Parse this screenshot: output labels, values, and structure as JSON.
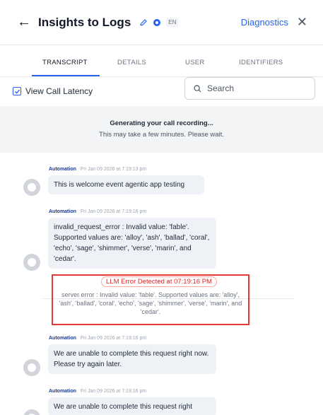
{
  "header": {
    "title": "Insights to Logs",
    "language_badge": "EN",
    "diagnostics_label": "Diagnostics",
    "back_icon": "←",
    "close_icon": "✕"
  },
  "tabs": [
    {
      "label": "TRANSCRIPT",
      "active": true
    },
    {
      "label": "DETAILS",
      "active": false
    },
    {
      "label": "USER",
      "active": false
    },
    {
      "label": "IDENTIFIERS",
      "active": false
    }
  ],
  "latency": {
    "label": "View Call Latency",
    "checked": true
  },
  "search": {
    "placeholder": "Search",
    "value": ""
  },
  "notice": {
    "title": "Generating your call recording...",
    "subtitle": "This may take a few minutes. Please wait."
  },
  "messages": [
    {
      "author": "Automation",
      "time": "Fri Jan 09 2026 at 7:19:13 pm",
      "text": "This is welcome event agentic app testing"
    },
    {
      "author": "Automation",
      "time": "Fri Jan 09 2026 at 7:19:16 pm",
      "text": "invalid_request_error : Invalid value: 'fable'. Supported values are: 'alloy', 'ash', 'ballad', 'coral', 'echo', 'sage', 'shimmer', 'verse', 'marin', and 'cedar'."
    },
    {
      "author": "Automation",
      "time": "Fri Jan 09 2026 at 7:19:16 pm",
      "text": "We are unable to complete this request right now. Please try again later."
    },
    {
      "author": "Automation",
      "time": "Fri Jan 09 2026 at 7:19:16 pm",
      "text": "We are unable to complete this request right"
    }
  ],
  "error": {
    "badge": "LLM Error Detected at 07:19:16 PM",
    "detail": "server error : Invalid value: 'fable'. Supported values are: 'alloy', 'ash', 'ballad', 'coral', 'echo', 'sage', 'shimmer', 'verse', 'marin', and 'cedar'."
  },
  "colors": {
    "accent": "#2563eb",
    "error": "#e53935",
    "bubble": "#eef2f7",
    "notice_bg": "#f3f4f6"
  }
}
